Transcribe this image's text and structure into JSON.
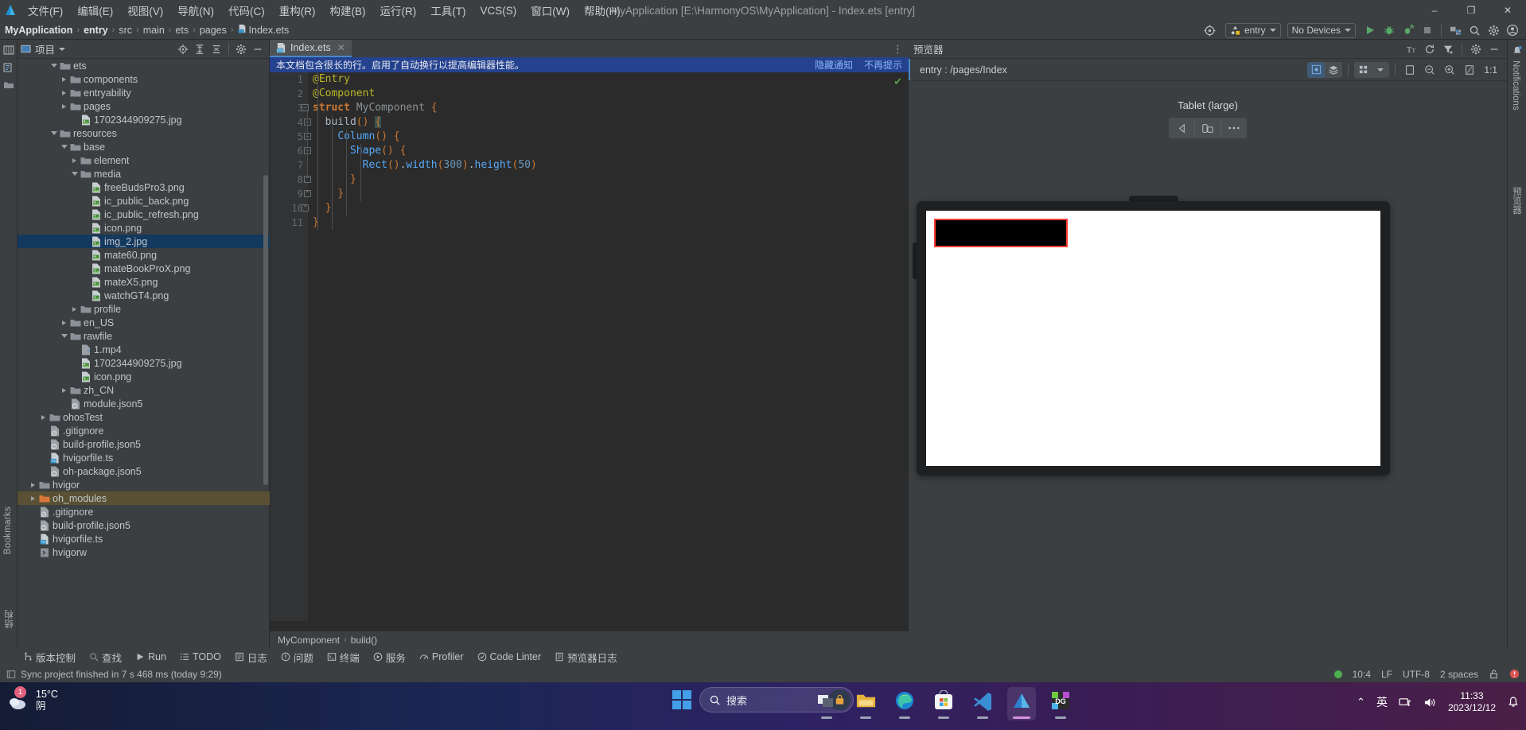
{
  "window": {
    "title": "MyApplication [E:\\HarmonyOS\\MyApplication] - Index.ets [entry]",
    "minimize": "–",
    "maximize": "❐",
    "close": "✕"
  },
  "menubar": {
    "items": [
      {
        "label": "文件(F)"
      },
      {
        "label": "编辑(E)"
      },
      {
        "label": "视图(V)"
      },
      {
        "label": "导航(N)"
      },
      {
        "label": "代码(C)"
      },
      {
        "label": "重构(R)"
      },
      {
        "label": "构建(B)"
      },
      {
        "label": "运行(R)"
      },
      {
        "label": "工具(T)"
      },
      {
        "label": "VCS(S)"
      },
      {
        "label": "窗口(W)"
      },
      {
        "label": "帮助(H)"
      }
    ]
  },
  "breadcrumb": {
    "items": [
      "MyApplication",
      "entry",
      "src",
      "main",
      "ets",
      "pages",
      "Index.ets"
    ]
  },
  "toolbar": {
    "run_config": "entry",
    "device": "No Devices",
    "icons": [
      "target-icon",
      "run-icon",
      "debug-icon",
      "profile-run-icon",
      "stop-icon",
      "device-manager-icon",
      "search-icon",
      "settings-icon",
      "account-icon"
    ]
  },
  "left_sidebar": {
    "bookmarks_label": "Bookmarks",
    "structure_label": "结构"
  },
  "right_sidebar": {
    "notifications_label": "Notifications",
    "preview_label": "预览器"
  },
  "project_panel": {
    "title": "项目",
    "header_icons": [
      "locate-icon",
      "expand-all-icon",
      "collapse-all-icon",
      "settings-icon",
      "hide-icon"
    ],
    "tree": [
      {
        "indent": 3,
        "twisty": "open",
        "icon": "folder",
        "label": "ets"
      },
      {
        "indent": 4,
        "twisty": "closed",
        "icon": "folder",
        "label": "components"
      },
      {
        "indent": 4,
        "twisty": "closed",
        "icon": "folder",
        "label": "entryability"
      },
      {
        "indent": 4,
        "twisty": "closed",
        "icon": "folder",
        "label": "pages"
      },
      {
        "indent": 5,
        "twisty": "none",
        "icon": "image",
        "label": "1702344909275.jpg"
      },
      {
        "indent": 3,
        "twisty": "open",
        "icon": "folder",
        "label": "resources"
      },
      {
        "indent": 4,
        "twisty": "open",
        "icon": "folder",
        "label": "base"
      },
      {
        "indent": 5,
        "twisty": "closed",
        "icon": "folder",
        "label": "element"
      },
      {
        "indent": 5,
        "twisty": "open",
        "icon": "folder",
        "label": "media"
      },
      {
        "indent": 6,
        "twisty": "none",
        "icon": "image",
        "label": "freeBudsPro3.png"
      },
      {
        "indent": 6,
        "twisty": "none",
        "icon": "image",
        "label": "ic_public_back.png"
      },
      {
        "indent": 6,
        "twisty": "none",
        "icon": "image",
        "label": "ic_public_refresh.png"
      },
      {
        "indent": 6,
        "twisty": "none",
        "icon": "image",
        "label": "icon.png"
      },
      {
        "indent": 6,
        "twisty": "none",
        "icon": "image",
        "label": "img_2.jpg",
        "state": "selected"
      },
      {
        "indent": 6,
        "twisty": "none",
        "icon": "image",
        "label": "mate60.png"
      },
      {
        "indent": 6,
        "twisty": "none",
        "icon": "image",
        "label": "mateBookProX.png"
      },
      {
        "indent": 6,
        "twisty": "none",
        "icon": "image",
        "label": "mateX5.png"
      },
      {
        "indent": 6,
        "twisty": "none",
        "icon": "image",
        "label": "watchGT4.png"
      },
      {
        "indent": 5,
        "twisty": "closed",
        "icon": "folder",
        "label": "profile"
      },
      {
        "indent": 4,
        "twisty": "closed",
        "icon": "folder",
        "label": "en_US"
      },
      {
        "indent": 4,
        "twisty": "open",
        "icon": "folder",
        "label": "rawfile"
      },
      {
        "indent": 5,
        "twisty": "none",
        "icon": "video",
        "label": "1.mp4"
      },
      {
        "indent": 5,
        "twisty": "none",
        "icon": "image",
        "label": "1702344909275.jpg"
      },
      {
        "indent": 5,
        "twisty": "none",
        "icon": "image",
        "label": "icon.png"
      },
      {
        "indent": 4,
        "twisty": "closed",
        "icon": "folder",
        "label": "zh_CN"
      },
      {
        "indent": 4,
        "twisty": "none",
        "icon": "json5",
        "label": "module.json5"
      },
      {
        "indent": 2,
        "twisty": "closed",
        "icon": "folder",
        "label": "ohosTest"
      },
      {
        "indent": 2,
        "twisty": "none",
        "icon": "gitignore",
        "label": ".gitignore"
      },
      {
        "indent": 2,
        "twisty": "none",
        "icon": "json5",
        "label": "build-profile.json5"
      },
      {
        "indent": 2,
        "twisty": "none",
        "icon": "ts",
        "label": "hvigorfile.ts"
      },
      {
        "indent": 2,
        "twisty": "none",
        "icon": "json5",
        "label": "oh-package.json5"
      },
      {
        "indent": 1,
        "twisty": "closed",
        "icon": "folder",
        "label": "hvigor"
      },
      {
        "indent": 1,
        "twisty": "closed",
        "icon": "folder-orange",
        "label": "oh_modules",
        "state": "selected-warm"
      },
      {
        "indent": 1,
        "twisty": "none",
        "icon": "gitignore",
        "label": ".gitignore"
      },
      {
        "indent": 1,
        "twisty": "none",
        "icon": "json5",
        "label": "build-profile.json5"
      },
      {
        "indent": 1,
        "twisty": "none",
        "icon": "ts",
        "label": "hvigorfile.ts"
      },
      {
        "indent": 1,
        "twisty": "none",
        "icon": "script",
        "label": "hvigorw"
      }
    ]
  },
  "editor": {
    "tab": {
      "label": "Index.ets",
      "close": "✕"
    },
    "notification": {
      "message": "本文档包含很长的行。启用了自动换行以提高编辑器性能。",
      "link_hide": "隐藏通知",
      "link_never": "不再提示"
    },
    "code_lines": [
      {
        "n": 1,
        "text": "@Entry"
      },
      {
        "n": 2,
        "text": "@Component"
      },
      {
        "n": 3,
        "text": "struct MyComponent {"
      },
      {
        "n": 4,
        "text": "  build() {"
      },
      {
        "n": 5,
        "text": "    Column() {"
      },
      {
        "n": 6,
        "text": "      Shape() {"
      },
      {
        "n": 7,
        "text": "        Rect().width(300).height(50)"
      },
      {
        "n": 8,
        "text": "      }"
      },
      {
        "n": 9,
        "text": "    }"
      },
      {
        "n": 10,
        "text": "  }"
      },
      {
        "n": 11,
        "text": "}"
      }
    ],
    "structure_breadcrumb": [
      "MyComponent",
      "build()"
    ],
    "inspection_status": "✔"
  },
  "previewer": {
    "title": "预览器",
    "header_icons": [
      "font-size-icon",
      "refresh-icon",
      "filter-icon",
      "settings-icon",
      "hide-icon"
    ],
    "route": "entry : /pages/Index",
    "toolbar_icons": [
      "inspector-icon",
      "layers-icon",
      "multi-device-icon",
      "chevron-down-icon",
      "fit-icon",
      "zoom-out-icon",
      "zoom-in-icon",
      "rotate-icon"
    ],
    "zoom_level": "1:1",
    "device_name": "Tablet (large)",
    "nav_controls": [
      "back-icon",
      "multi-window-icon",
      "more-icon"
    ]
  },
  "tool_windows": [
    {
      "label": "版本控制",
      "icon": "branch-icon"
    },
    {
      "label": "查找",
      "icon": "search-icon"
    },
    {
      "label": "Run",
      "icon": "run-icon"
    },
    {
      "label": "TODO",
      "icon": "todo-icon"
    },
    {
      "label": "日志",
      "icon": "log-icon"
    },
    {
      "label": "问题",
      "icon": "problems-icon"
    },
    {
      "label": "终端",
      "icon": "terminal-icon"
    },
    {
      "label": "服务",
      "icon": "services-icon"
    },
    {
      "label": "Profiler",
      "icon": "profiler-icon"
    },
    {
      "label": "Code Linter",
      "icon": "linter-icon"
    },
    {
      "label": "预览器日志",
      "icon": "preview-log-icon"
    }
  ],
  "statusbar": {
    "message": "Sync project finished in 7 s 468 ms (today 9:29)",
    "caret": "10:4",
    "line_sep": "LF",
    "encoding": "UTF-8",
    "indent": "2 spaces",
    "lock_icon": "unlocked-icon",
    "error_icon": "error-icon"
  },
  "taskbar": {
    "weather_temp": "15°C",
    "weather_desc": "阴",
    "weather_badge": "1",
    "search_placeholder": "搜索",
    "apps": [
      "task-view-icon",
      "file-explorer-icon",
      "edge-icon",
      "microsoft-store-icon",
      "vscode-icon",
      "deveco-studio-icon",
      "datagrip-icon"
    ],
    "tray": [
      "chevron-up-icon",
      "ime-icon",
      "network-icon",
      "volume-icon"
    ],
    "ime_label": "英",
    "time": "11:33",
    "date": "2023/12/12",
    "notification_icon": "bell-icon"
  },
  "colors": {
    "accent_blue": "#4a88c7",
    "selection_blue": "#13395e",
    "selection_warm": "#5a5134",
    "notif_blue": "#25428f",
    "preview_outline": "#ff3b30"
  }
}
